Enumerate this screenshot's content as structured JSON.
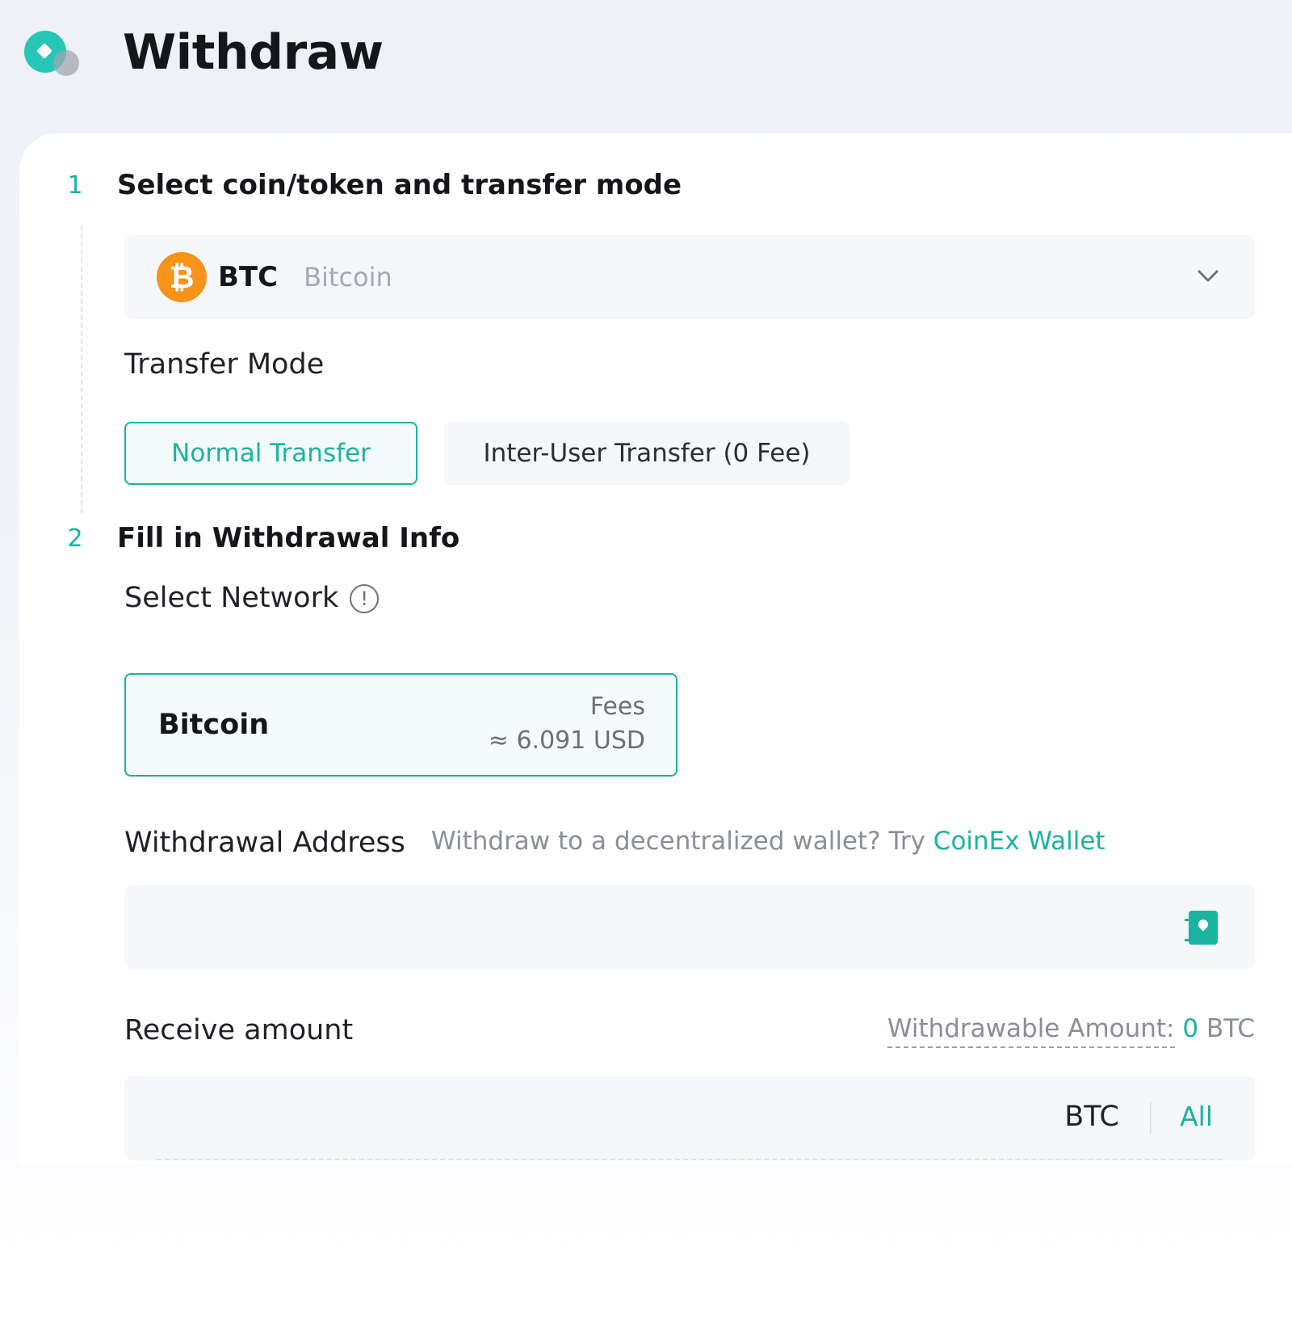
{
  "header": {
    "title": "Withdraw"
  },
  "steps": [
    {
      "number": "1",
      "title": "Select coin/token and transfer mode"
    },
    {
      "number": "2",
      "title": "Fill in Withdrawal Info"
    }
  ],
  "coin": {
    "symbol": "BTC",
    "name": "Bitcoin",
    "icon": "bitcoin-icon",
    "color": "#f7931a"
  },
  "transfer_mode": {
    "label": "Transfer Mode",
    "options": [
      "Normal Transfer",
      "Inter-User Transfer (0 Fee)"
    ],
    "selected": "Normal Transfer"
  },
  "network": {
    "label": "Select Network",
    "selected": {
      "name": "Bitcoin",
      "fee_label": "Fees",
      "fee_value": "≈ 6.091 USD"
    }
  },
  "address": {
    "label": "Withdrawal Address",
    "hint": "Withdraw to a decentralized wallet? Try ",
    "hint_link": "CoinEx Wallet",
    "value": ""
  },
  "amount": {
    "label": "Receive amount",
    "withdrawable_label": "Withdrawable Amount:",
    "withdrawable_value": "0",
    "withdrawable_unit": "BTC",
    "unit": "BTC",
    "all_label": "All",
    "value": ""
  },
  "colors": {
    "accent": "#1ab39f",
    "brand": "#27c6b6"
  }
}
